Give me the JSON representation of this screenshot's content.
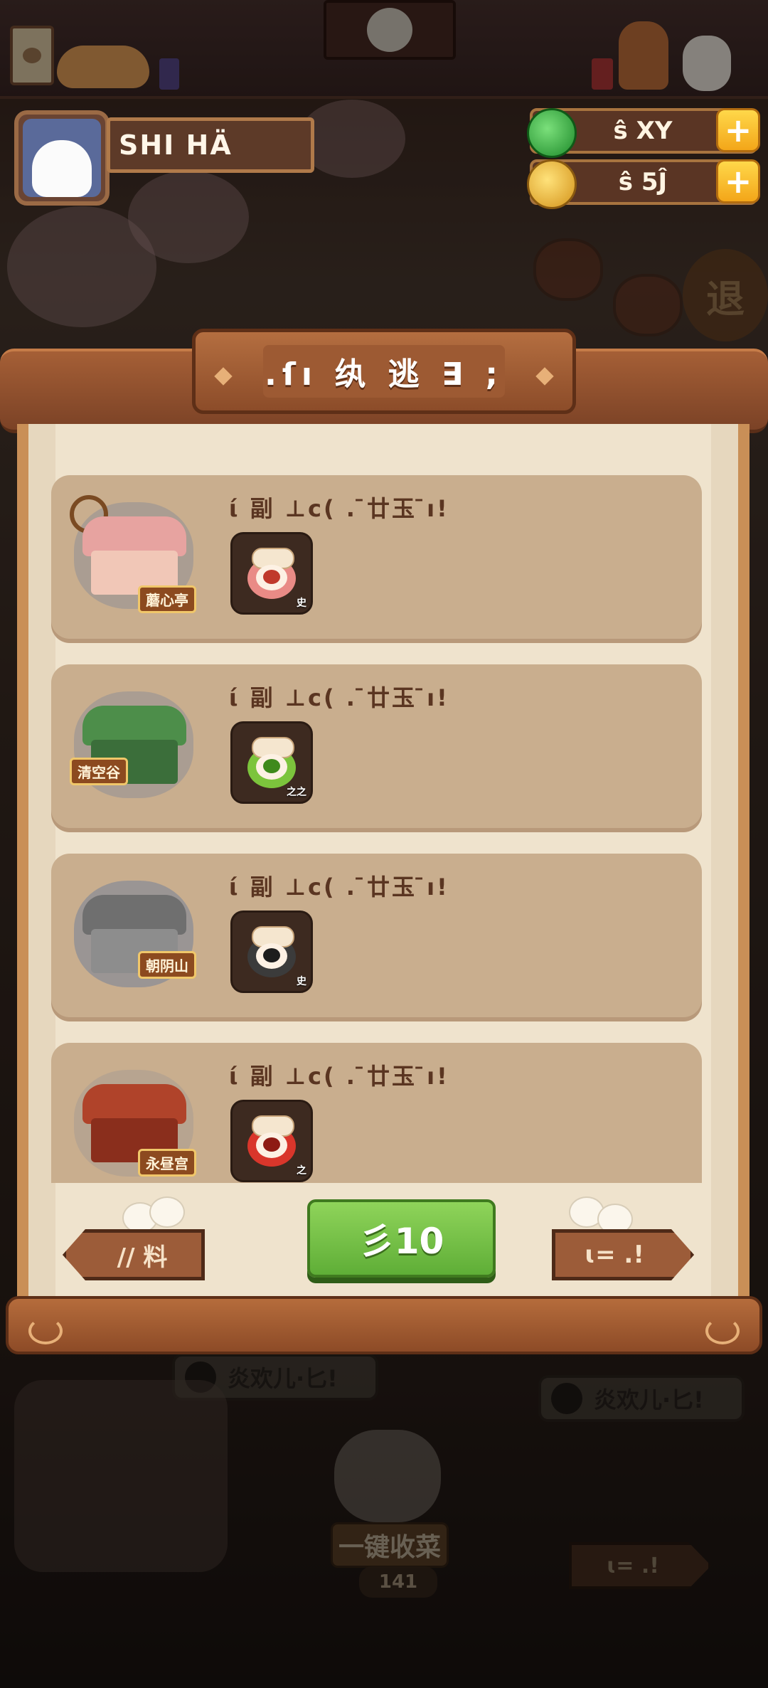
{
  "player": {
    "name": "SHI HÄ"
  },
  "currency": [
    {
      "icon": "jade-icon",
      "value": "ŝ XY",
      "color": "#2fae3a"
    },
    {
      "icon": "coin-icon",
      "value": "ŝ 5Ĵ",
      "color": "#f0b52c"
    }
  ],
  "dialog": {
    "title": ".ſı 纨 逃 ∃ ;",
    "cards": [
      {
        "title": "ί 副 ⊥c( . ̄廿玉 ̄ı!",
        "building_label": "蘑心亭",
        "item_tag": "史",
        "item_color": "#e98b86",
        "item_core": "#c0392b",
        "roof": "#e7a3a0",
        "wall": "#f1c7b7"
      },
      {
        "title": "ί 副 ⊥c( . ̄廿玉 ̄ı!",
        "building_label": "清空谷",
        "item_tag": "之之",
        "item_color": "#7cc43c",
        "item_core": "#3f8a1c",
        "roof": "#4d8e4a",
        "wall": "#3b6e3a"
      },
      {
        "title": "ί 副 ⊥c( . ̄廿玉 ̄ı!",
        "building_label": "朝阴山",
        "item_tag": "史",
        "item_color": "#3b3b3b",
        "item_core": "#1d1d1d",
        "roof": "#6f6f6f",
        "wall": "#8d8d8d"
      },
      {
        "title": "ί 副 ⊥c( . ̄廿玉 ̄ı!",
        "building_label": "永昼宫",
        "item_tag": "之",
        "item_color": "#d9362b",
        "item_core": "#8e1b14",
        "roof": "#b0432a",
        "wall": "#8a2e1c"
      }
    ],
    "prev_label": "// 料",
    "confirm_label": "彡10",
    "next_label": "ɩ= .!"
  },
  "background": {
    "timer_left": "炎欢儿·匕!",
    "timer_right": "炎欢儿·匕!",
    "harvest_label": "一键收菜",
    "harvest_count": "141",
    "next_label": "ɩ= .!",
    "exit_label": "退"
  }
}
